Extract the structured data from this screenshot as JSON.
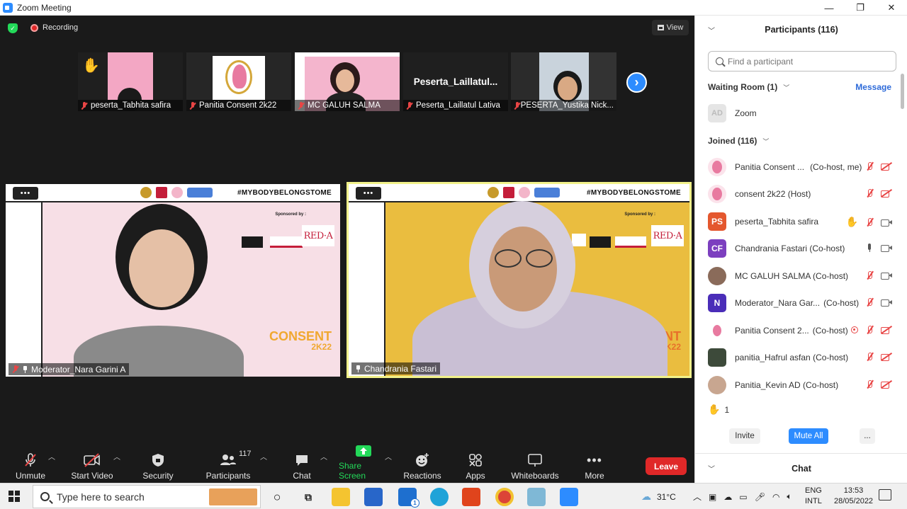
{
  "window": {
    "title": "Zoom Meeting",
    "minimize": "—",
    "restore": "❐",
    "close": "✕"
  },
  "meeting": {
    "recording_label": "Recording",
    "view_label": "View",
    "thumbnails": [
      {
        "name": "peserta_Tabhita safira"
      },
      {
        "name": "Panitia Consent 2k22"
      },
      {
        "name": "MC GALUH SALMA"
      },
      {
        "name": "Peserta_Laillatul Lativa",
        "title": "Peserta_Laillatul..."
      },
      {
        "name": "PESERTA_Yustika Nick..."
      }
    ],
    "videos": [
      {
        "name": "Moderator_Nara Garini A",
        "hashtag": "#MYBODYBELONGSTOME",
        "sponsored": "Sponsored by :",
        "consent": "CONSENT",
        "year": "2K22",
        "brand": "RED·A"
      },
      {
        "name": "Chandrania Fastari",
        "hashtag": "#MYBODYBELONGSTOME",
        "sponsored": "Sponsored by :",
        "consent": "NSENT",
        "year": "2K22",
        "brand": "RED·A"
      }
    ],
    "toolbar": {
      "unmute": "Unmute",
      "start_video": "Start Video",
      "security": "Security",
      "participants": "Participants",
      "participants_count": "117",
      "chat": "Chat",
      "share_screen": "Share Screen",
      "reactions": "Reactions",
      "apps": "Apps",
      "whiteboards": "Whiteboards",
      "more": "More",
      "leave": "Leave"
    },
    "colors": {
      "accent": "#2d8cff",
      "leave": "#e02828",
      "share": "#23d959",
      "active_speaker": "#f1f18a"
    }
  },
  "panel": {
    "title": "Participants (116)",
    "search_placeholder": "Find a participant",
    "waiting_room": "Waiting Room (1)",
    "message": "Message",
    "waiting": [
      {
        "name": "Zoom",
        "avatar": "AD"
      }
    ],
    "joined": "Joined (116)",
    "participants": [
      {
        "name": "Panitia Consent ...",
        "role": "(Co-host, me)"
      },
      {
        "name": "consent 2k22 (Host)",
        "role": ""
      },
      {
        "name": "peserta_Tabhita safira",
        "role": "",
        "initials": "PS"
      },
      {
        "name": "Chandrania Fastari (Co-host)",
        "role": "",
        "initials": "CF"
      },
      {
        "name": "MC GALUH SALMA (Co-host)",
        "role": ""
      },
      {
        "name": "Moderator_Nara Gar...",
        "role": "(Co-host)",
        "initials": "N"
      },
      {
        "name": "Panitia Consent 2...",
        "role": "(Co-host)"
      },
      {
        "name": "panitia_Hafrul asfan (Co-host)",
        "role": ""
      },
      {
        "name": "Panitia_Kevin AD (Co-host)",
        "role": ""
      }
    ],
    "raised_hands": "1",
    "invite": "Invite",
    "mute_all": "Mute All",
    "more": "...",
    "chat": "Chat"
  },
  "taskbar": {
    "search_placeholder": "Type here to search",
    "weather": "31°C",
    "lang_top": "ENG",
    "lang_bottom": "INTL",
    "time": "13:53",
    "date": "28/05/2022",
    "mail_badge": "1"
  }
}
